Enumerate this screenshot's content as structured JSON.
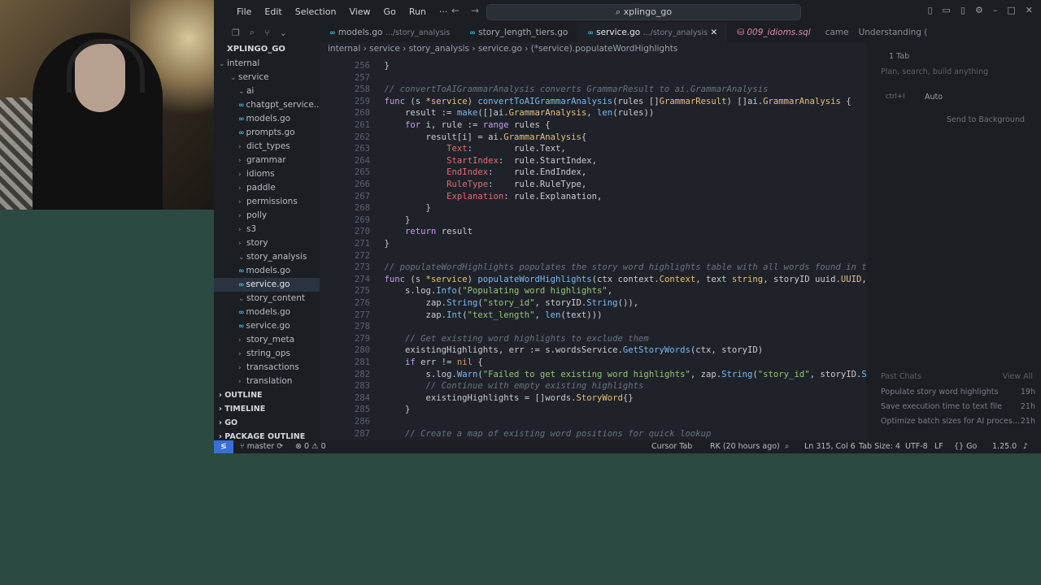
{
  "menu": [
    "File",
    "Edit",
    "Selection",
    "View",
    "Go",
    "Run",
    "···"
  ],
  "search_text": "xplingo_go",
  "tabs": [
    {
      "name": "models.go",
      "dir": ".../story_analysis"
    },
    {
      "name": "story_length_tiers.go",
      "dir": ""
    },
    {
      "name": "service.go",
      "dir": ".../story_analysis"
    },
    {
      "name": "009_idioms.sql",
      "dir": ""
    }
  ],
  "tab_extra": [
    "came",
    "Understanding ("
  ],
  "explorer_title": "XPLINGO_GO",
  "tree": [
    {
      "label": "internal",
      "indent": 6,
      "type": "folder-open"
    },
    {
      "label": "service",
      "indent": 20,
      "type": "folder-open"
    },
    {
      "label": "ai",
      "indent": 30,
      "type": "folder-open"
    },
    {
      "label": "chatgpt_service...",
      "indent": 30,
      "type": "go"
    },
    {
      "label": "models.go",
      "indent": 30,
      "type": "go"
    },
    {
      "label": "prompts.go",
      "indent": 30,
      "type": "go"
    },
    {
      "label": "dict_types",
      "indent": 30,
      "type": "folder"
    },
    {
      "label": "grammar",
      "indent": 30,
      "type": "folder"
    },
    {
      "label": "idioms",
      "indent": 30,
      "type": "folder"
    },
    {
      "label": "paddle",
      "indent": 30,
      "type": "folder"
    },
    {
      "label": "permissions",
      "indent": 30,
      "type": "folder"
    },
    {
      "label": "polly",
      "indent": 30,
      "type": "folder"
    },
    {
      "label": "s3",
      "indent": 30,
      "type": "folder"
    },
    {
      "label": "story",
      "indent": 30,
      "type": "folder"
    },
    {
      "label": "story_analysis",
      "indent": 30,
      "type": "folder-open"
    },
    {
      "label": "models.go",
      "indent": 30,
      "type": "go"
    },
    {
      "label": "service.go",
      "indent": 30,
      "type": "go",
      "active": true
    },
    {
      "label": "story_content",
      "indent": 30,
      "type": "folder-open"
    },
    {
      "label": "models.go",
      "indent": 30,
      "type": "go"
    },
    {
      "label": "service.go",
      "indent": 30,
      "type": "go"
    },
    {
      "label": "story_meta",
      "indent": 30,
      "type": "folder"
    },
    {
      "label": "string_ops",
      "indent": 30,
      "type": "folder"
    },
    {
      "label": "transactions",
      "indent": 30,
      "type": "folder"
    },
    {
      "label": "translation",
      "indent": 30,
      "type": "folder"
    }
  ],
  "sections": [
    "OUTLINE",
    "TIMELINE",
    "GO",
    "PACKAGE OUTLINE"
  ],
  "breadcrumb": "internal › service › story_analysis › service.go › (*service).populateWordHighlights",
  "code_lines": [
    {
      "n": "256",
      "html": "}"
    },
    {
      "n": "257",
      "html": ""
    },
    {
      "n": "258",
      "html": "<span class=cm>// convertToAIGrammarAnalysis converts GrammarResult to ai.GrammarAnalysis</span>"
    },
    {
      "n": "259",
      "html": "<span class=kw>func</span> (s <span class=ty>*service</span>) <span class=fn>convertToAIGrammarAnalysis</span>(rules []<span class=ty>GrammarResult</span>) []ai.<span class=ty>GrammarAnalysis</span> {"
    },
    {
      "n": "260",
      "html": "    result := <span class=fn>make</span>([]ai.<span class=ty>GrammarAnalysis</span>, <span class=fn>len</span>(rules))"
    },
    {
      "n": "261",
      "html": "    <span class=kw>for</span> i, rule := <span class=kw>range</span> rules {"
    },
    {
      "n": "262",
      "html": "        result[i] = ai.<span class=ty>GrammarAnalysis</span>{"
    },
    {
      "n": "263",
      "html": "            <span class=fld>Text</span>:        rule.Text,"
    },
    {
      "n": "264",
      "html": "            <span class=fld>StartIndex</span>:  rule.StartIndex,"
    },
    {
      "n": "265",
      "html": "            <span class=fld>EndIndex</span>:    rule.EndIndex,"
    },
    {
      "n": "266",
      "html": "            <span class=fld>RuleType</span>:    rule.RuleType,"
    },
    {
      "n": "267",
      "html": "            <span class=fld>Explanation</span>: rule.Explanation,"
    },
    {
      "n": "268",
      "html": "        }"
    },
    {
      "n": "269",
      "html": "    }"
    },
    {
      "n": "270",
      "html": "    <span class=kw>return</span> result"
    },
    {
      "n": "271",
      "html": "}"
    },
    {
      "n": "272",
      "html": ""
    },
    {
      "n": "273",
      "html": "<span class=cm>// populateWordHighlights populates the story word highlights table with all words found in the</span>"
    },
    {
      "n": "274",
      "html": "<span class=kw>func</span> (s <span class=ty>*service</span>) <span class=fn>populateWordHighlights</span>(ctx context.<span class=ty>Context</span>, text <span class=ty>string</span>, storyID uuid.<span class=ty>UUID</span>, sc"
    },
    {
      "n": "275",
      "html": "    s.log.<span class=fn>Info</span>(<span class=str>\"Populating word highlights\"</span>,"
    },
    {
      "n": "276",
      "html": "        zap.<span class=fn>String</span>(<span class=str>\"story_id\"</span>, storyID.<span class=fn>String</span>()),"
    },
    {
      "n": "277",
      "html": "        zap.<span class=fn>Int</span>(<span class=str>\"text_length\"</span>, <span class=fn>len</span>(text)))"
    },
    {
      "n": "278",
      "html": ""
    },
    {
      "n": "279",
      "html": "    <span class=cm>// Get existing word highlights to exclude them</span>"
    },
    {
      "n": "280",
      "html": "    existingHighlights, err := s.wordsService.<span class=fn>GetStoryWords</span>(ctx, storyID)"
    },
    {
      "n": "281",
      "html": "    <span class=kw>if</span> err != <span class=nm>nil</span> {"
    },
    {
      "n": "282",
      "html": "        s.log.<span class=fn>Warn</span>(<span class=str>\"Failed to get existing word highlights\"</span>, zap.<span class=fn>String</span>(<span class=str>\"story_id\"</span>, storyID.<span class=fn>Stri</span>"
    },
    {
      "n": "283",
      "html": "        <span class=cm>// Continue with empty existing highlights</span>"
    },
    {
      "n": "284",
      "html": "        existingHighlights = []words.<span class=ty>StoryWord</span>{}"
    },
    {
      "n": "285",
      "html": "    }"
    },
    {
      "n": "286",
      "html": ""
    },
    {
      "n": "287",
      "html": "    <span class=cm>// Create a map of existing word positions for quick lookup</span>"
    }
  ],
  "chat": {
    "tab_label": "1 Tab",
    "placeholder": "Plan, search, build anything",
    "mode": "ctrl+I",
    "model": "Auto",
    "send_bg": "Send to Background",
    "past_chats": "Past Chats",
    "view_all": "View All",
    "history": [
      {
        "title": "Populate story word highlights",
        "ago": "19h"
      },
      {
        "title": "Save execution time to text file",
        "ago": "21h"
      },
      {
        "title": "Optimize batch sizes for AI proces...",
        "ago": "21h"
      }
    ]
  },
  "status": {
    "branch": "master",
    "problems": "⊗ 0 ⚠ 0",
    "cursor_tab": "Cursor Tab",
    "author": "RK (20 hours ago)",
    "position": "Ln 315, Col 6",
    "tab_size": "Tab Size: 4",
    "encoding": "UTF-8",
    "eol": "LF",
    "lang": "Go",
    "version": "1.25.0"
  }
}
